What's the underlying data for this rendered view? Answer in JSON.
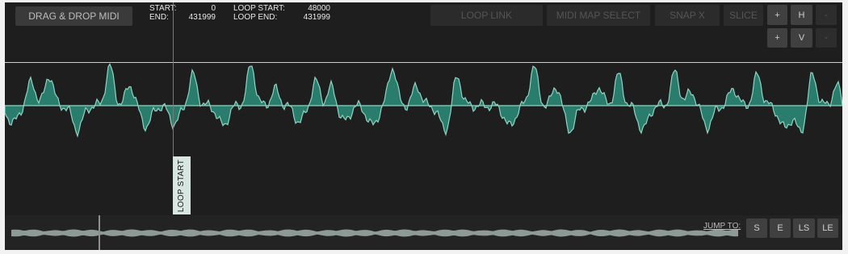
{
  "header": {
    "drag_drop_label": "DRAG & DROP MIDI",
    "start_label": "START:",
    "start_value": "0",
    "end_label": "END:",
    "end_value": "431999",
    "loop_start_label": "LOOP START:",
    "loop_start_value": "48000",
    "loop_end_label": "LOOP END:",
    "loop_end_value": "431999"
  },
  "toolbar": {
    "loop_link": "LOOP LINK",
    "midi_map_select": "MIDI MAP SELECT",
    "snap_x": "SNAP X",
    "slice": "SLICE"
  },
  "zoom": {
    "h_plus": "+",
    "h_label": "H",
    "h_minus": "-",
    "v_plus": "+",
    "v_label": "V",
    "v_minus": "-"
  },
  "markers": {
    "loop_start": "LOOP START"
  },
  "jump": {
    "label": "JUMP TO:",
    "s": "S",
    "e": "E",
    "ls": "LS",
    "le": "LE"
  },
  "colors": {
    "waveform_fill": "#2a7d6d",
    "waveform_stroke": "#8fd4c2",
    "overview_wave": "#8d9a97"
  }
}
